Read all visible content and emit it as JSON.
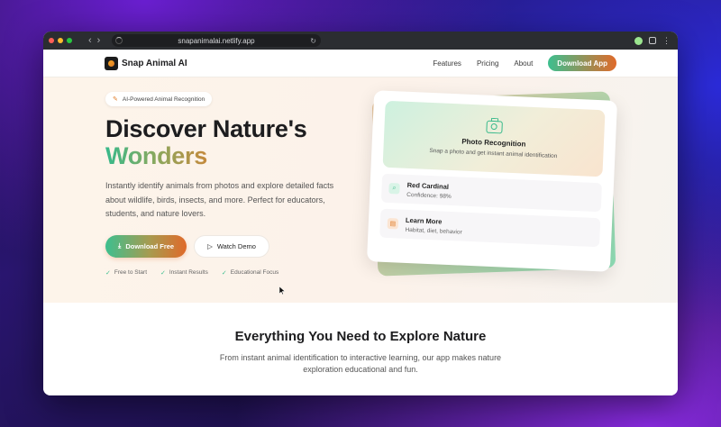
{
  "browser": {
    "url": "snapanimalai.netlify.app",
    "traffic_colors": [
      "#ff5f57",
      "#febc2e",
      "#28c840"
    ]
  },
  "nav": {
    "brand": "Snap Animal AI",
    "links": [
      "Features",
      "Pricing",
      "About"
    ],
    "cta": "Download App"
  },
  "hero": {
    "badge": "AI-Powered Animal Recognition",
    "title_line1": "Discover Nature's",
    "title_line2": "Wonders",
    "lead": "Instantly identify animals from photos and explore detailed facts about wildlife, birds, insects, and more. Perfect for educators, students, and nature lovers.",
    "primary_cta": "Download Free",
    "secondary_cta": "Watch Demo",
    "checks": [
      "Free to Start",
      "Instant Results",
      "Educational Focus"
    ]
  },
  "card": {
    "photo_title": "Photo Recognition",
    "photo_sub": "Snap a photo and get instant animal identification",
    "rows": [
      {
        "title": "Red Cardinal",
        "sub": "Confidence: 98%"
      },
      {
        "title": "Learn More",
        "sub": "Habitat, diet, behavior"
      }
    ]
  },
  "features": {
    "title": "Everything You Need to Explore Nature",
    "sub": "From instant animal identification to interactive learning, our app makes nature exploration educational and fun."
  },
  "colors": {
    "accent_green": "#3dbf8f",
    "accent_orange": "#e06a2a"
  }
}
